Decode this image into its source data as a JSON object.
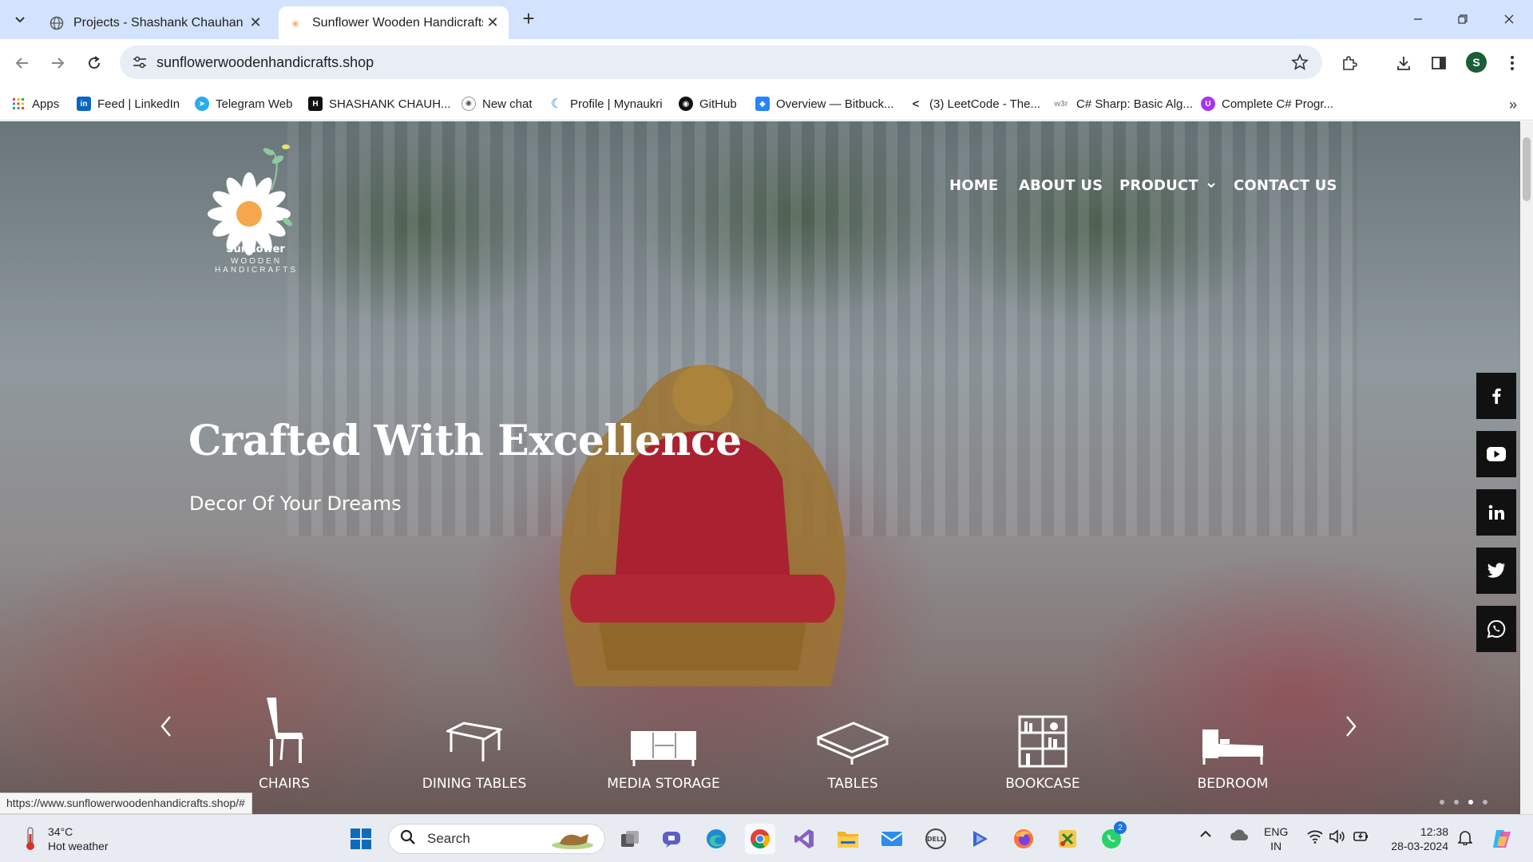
{
  "browser": {
    "tabs": [
      {
        "title": "Projects - Shashank Chauhan",
        "active": false
      },
      {
        "title": "Sunflower Wooden Handicrafts",
        "active": true
      }
    ],
    "url": "sunflowerwoodenhandicrafts.shop",
    "profile_initial": "S",
    "bookmarks": [
      {
        "label": "Apps",
        "icon": "apps-grid-icon"
      },
      {
        "label": "Feed | LinkedIn",
        "icon": "linkedin-icon"
      },
      {
        "label": "Telegram Web",
        "icon": "telegram-icon"
      },
      {
        "label": "SHASHANK CHAUH...",
        "icon": "hackerrank-icon"
      },
      {
        "label": "New chat",
        "icon": "chatgpt-icon"
      },
      {
        "label": "Profile | Mynaukri",
        "icon": "naukri-icon"
      },
      {
        "label": "GitHub",
        "icon": "github-icon"
      },
      {
        "label": "Overview — Bitbuck...",
        "icon": "bitbucket-icon"
      },
      {
        "label": "(3) LeetCode - The...",
        "icon": "leetcode-icon"
      },
      {
        "label": "C# Sharp: Basic Alg...",
        "icon": "w3resource-icon"
      },
      {
        "label": "Complete C# Progr...",
        "icon": "udemy-icon"
      }
    ]
  },
  "site": {
    "logo": {
      "name": "Sunflower",
      "tagline": "WOODEN HANDICRAFTS"
    },
    "nav": {
      "home": "HOME",
      "about": "ABOUT US",
      "product": "PRODUCT",
      "contact": "CONTACT US"
    },
    "hero": {
      "title": "Crafted With Excellence",
      "subtitle": "Decor Of Your Dreams"
    },
    "social": [
      "facebook-icon",
      "youtube-icon",
      "linkedin-icon",
      "twitter-icon",
      "whatsapp-icon"
    ],
    "categories": [
      {
        "label": "CHAIRS",
        "icon": "chair-icon"
      },
      {
        "label": "DINING TABLES",
        "icon": "dining-table-icon"
      },
      {
        "label": "MEDIA STORAGE",
        "icon": "media-storage-icon"
      },
      {
        "label": "TABLES",
        "icon": "table-icon"
      },
      {
        "label": "BOOKCASE",
        "icon": "bookcase-icon"
      },
      {
        "label": "BEDROOM",
        "icon": "bed-icon"
      }
    ],
    "carousel_dots": {
      "count": 4,
      "active_index": 2
    }
  },
  "status_url": "https://www.sunflowerwoodenhandicrafts.shop/#",
  "taskbar": {
    "weather": {
      "temp": "34°C",
      "desc": "Hot weather"
    },
    "search_placeholder": "Search",
    "whatsapp_badge": "2",
    "lang": {
      "line1": "ENG",
      "line2": "IN"
    },
    "clock": {
      "time": "12:38",
      "date": "28-03-2024"
    }
  },
  "colors": {
    "tabstrip": "#d3e3fd",
    "taskbar": "#e8ecf2",
    "social_bg": "#111111"
  }
}
